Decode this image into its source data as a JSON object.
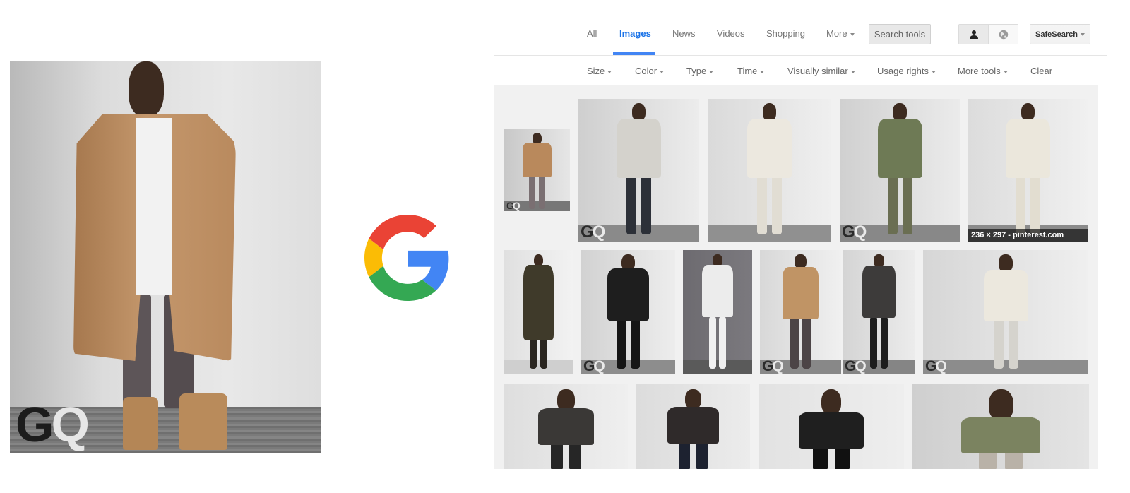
{
  "query_image": {
    "alt": "Man in camel overcoat, white tee, grey pants and tan boots",
    "watermark": {
      "g": "G",
      "q": "Q"
    }
  },
  "logo": {
    "name": "Google G",
    "colors": {
      "red": "#EA4335",
      "yellow": "#FBBC05",
      "green": "#34A853",
      "blue": "#4285F4"
    }
  },
  "nav": {
    "tabs": [
      {
        "label": "All",
        "active": false
      },
      {
        "label": "Images",
        "active": true
      },
      {
        "label": "News",
        "active": false
      },
      {
        "label": "Videos",
        "active": false
      },
      {
        "label": "Shopping",
        "active": false
      },
      {
        "label": "More",
        "active": false,
        "dropdown": true
      }
    ],
    "search_tools_label": "Search tools",
    "account_toggle": [
      {
        "icon": "person-icon",
        "selected": true
      },
      {
        "icon": "globe-icon",
        "selected": false
      }
    ],
    "safesearch_label": "SafeSearch",
    "accent_color": "#4285F4",
    "active_tab_color": "#1A73E8"
  },
  "tools": {
    "items": [
      {
        "label": "Size",
        "dropdown": true
      },
      {
        "label": "Color",
        "dropdown": true
      },
      {
        "label": "Type",
        "dropdown": true
      },
      {
        "label": "Time",
        "dropdown": true
      },
      {
        "label": "Visually similar",
        "dropdown": true
      },
      {
        "label": "Usage rights",
        "dropdown": true
      },
      {
        "label": "More tools",
        "dropdown": true
      },
      {
        "label": "Clear",
        "dropdown": false
      }
    ]
  },
  "results": {
    "rows": [
      [
        {
          "desc": "camel overcoat (query match)",
          "gq": true
        },
        {
          "desc": "grey bomber jacket, dark jeans",
          "gq": true
        },
        {
          "desc": "cream layered knit, cream pants",
          "gq": false
        },
        {
          "desc": "olive parka and cargo pants",
          "gq": true
        },
        {
          "desc": "cream sweater and pants",
          "gq": false,
          "caption": "236 × 297 - pinterest.com"
        }
      ],
      [
        {
          "desc": "dark olive long coat",
          "gq": false
        },
        {
          "desc": "black leather jacket and pants",
          "gq": true
        },
        {
          "desc": "white sweater, white jeans, tan boots",
          "gq": false
        },
        {
          "desc": "camel coat flying, tan boots",
          "gq": true
        },
        {
          "desc": "charcoal sweater, crouching",
          "gq": true
        },
        {
          "desc": "cream outfit and grey bomber",
          "gq": true
        }
      ],
      [
        {
          "desc": "charcoal long-sleeve, crouching",
          "gq": false
        },
        {
          "desc": "black hoodie",
          "gq": false
        },
        {
          "desc": "black zip jacket, white tee",
          "gq": false
        },
        {
          "desc": "olive jacket, grey tee",
          "gq": false
        }
      ]
    ]
  }
}
